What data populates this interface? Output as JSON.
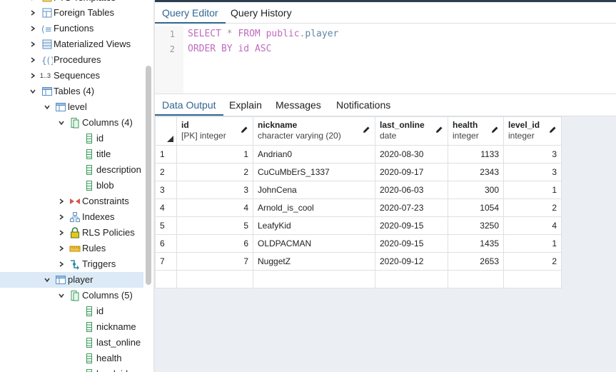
{
  "tree": {
    "partial_top": "FTS Templates",
    "items": [
      {
        "label": "Foreign Tables",
        "icon": "foreign-table-icon"
      },
      {
        "label": "Functions",
        "icon": "function-icon"
      },
      {
        "label": "Materialized Views",
        "icon": "materialized-view-icon"
      },
      {
        "label": "Procedures",
        "icon": "procedure-icon"
      },
      {
        "label": "Sequences",
        "icon": "sequence-icon"
      },
      {
        "label": "Tables (4)",
        "icon": "table-icon"
      },
      {
        "label": "level",
        "icon": "table-icon"
      },
      {
        "label": "Columns (4)",
        "icon": "columns-icon"
      },
      {
        "label": "id",
        "icon": "column-icon"
      },
      {
        "label": "title",
        "icon": "column-icon"
      },
      {
        "label": "description",
        "icon": "column-icon"
      },
      {
        "label": "blob",
        "icon": "column-icon"
      },
      {
        "label": "Constraints",
        "icon": "constraints-icon"
      },
      {
        "label": "Indexes",
        "icon": "indexes-icon"
      },
      {
        "label": "RLS Policies",
        "icon": "rls-policy-icon"
      },
      {
        "label": "Rules",
        "icon": "rules-icon"
      },
      {
        "label": "Triggers",
        "icon": "triggers-icon"
      },
      {
        "label": "player",
        "icon": "table-icon"
      },
      {
        "label": "Columns (5)",
        "icon": "columns-icon"
      },
      {
        "label": "id",
        "icon": "column-icon"
      },
      {
        "label": "nickname",
        "icon": "column-icon"
      },
      {
        "label": "last_online",
        "icon": "column-icon"
      },
      {
        "label": "health",
        "icon": "column-icon"
      },
      {
        "label": "level_id",
        "icon": "column-icon"
      }
    ],
    "sequence_badge": "1..3"
  },
  "editor_tabs": {
    "query_editor": "Query Editor",
    "query_history": "Query History"
  },
  "editor": {
    "line_numbers": [
      "1",
      "2"
    ],
    "line1": {
      "kw1": "SELECT",
      "op": "*",
      "kw2": "FROM",
      "schema": "public",
      "dot": ".",
      "table": "player"
    },
    "line2": {
      "kw1": "ORDER BY",
      "col": "id",
      "kw2": "ASC"
    }
  },
  "output_tabs": {
    "data_output": "Data Output",
    "explain": "Explain",
    "messages": "Messages",
    "notifications": "Notifications"
  },
  "grid": {
    "columns": [
      {
        "name": "id",
        "type": "[PK] integer"
      },
      {
        "name": "nickname",
        "type": "character varying (20)"
      },
      {
        "name": "last_online",
        "type": "date"
      },
      {
        "name": "health",
        "type": "integer"
      },
      {
        "name": "level_id",
        "type": "integer"
      }
    ],
    "rows": [
      {
        "n": "1",
        "id": "1",
        "nickname": "Andrian0",
        "last_online": "2020-08-30",
        "health": "1133",
        "level_id": "3"
      },
      {
        "n": "2",
        "id": "2",
        "nickname": "CuCuMbErS_1337",
        "last_online": "2020-09-17",
        "health": "2343",
        "level_id": "3"
      },
      {
        "n": "3",
        "id": "3",
        "nickname": "JohnCena",
        "last_online": "2020-06-03",
        "health": "300",
        "level_id": "1"
      },
      {
        "n": "4",
        "id": "4",
        "nickname": "Arnold_is_cool",
        "last_online": "2020-07-23",
        "health": "1054",
        "level_id": "2"
      },
      {
        "n": "5",
        "id": "5",
        "nickname": "LeafyKid",
        "last_online": "2020-09-15",
        "health": "3250",
        "level_id": "4"
      },
      {
        "n": "6",
        "id": "6",
        "nickname": "OLDPACMAN",
        "last_online": "2020-09-15",
        "health": "1435",
        "level_id": "1"
      },
      {
        "n": "7",
        "id": "7",
        "nickname": "NuggetZ",
        "last_online": "2020-09-12",
        "health": "2653",
        "level_id": "2"
      }
    ]
  }
}
